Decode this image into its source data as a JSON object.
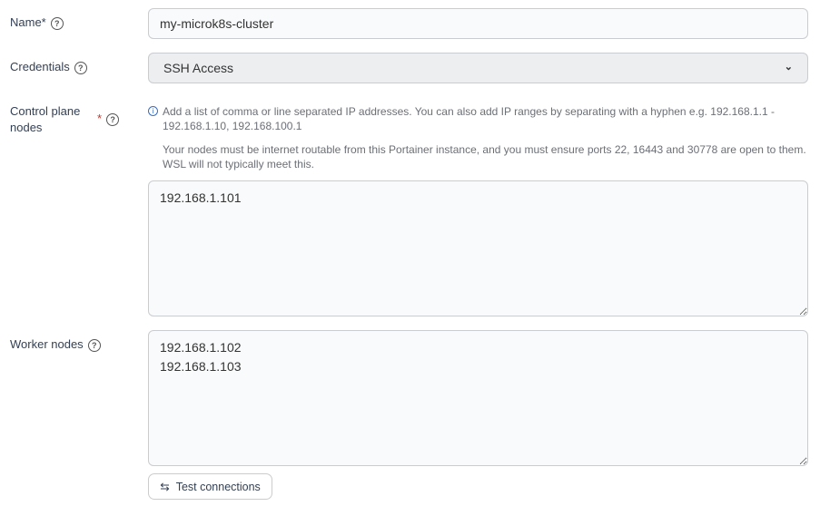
{
  "name": {
    "label": "Name*",
    "value": "my-microk8s-cluster"
  },
  "credentials": {
    "label": "Credentials",
    "value": "SSH Access"
  },
  "control_plane": {
    "label_line1": "Control plane",
    "label_line2": "nodes",
    "required": "*",
    "help1": "Add a list of comma or line separated IP addresses. You can also add IP ranges by separating with a hyphen e.g. 192.168.1.1 - 192.168.1.10, 192.168.100.1",
    "help2": "Your nodes must be internet routable from this Portainer instance, and you must ensure ports 22, 16443 and 30778 are open to them. WSL will not typically meet this.",
    "value": "192.168.1.101"
  },
  "worker": {
    "label": "Worker nodes",
    "value": "192.168.1.102\n192.168.1.103"
  },
  "test_button": {
    "label": "Test connections"
  }
}
